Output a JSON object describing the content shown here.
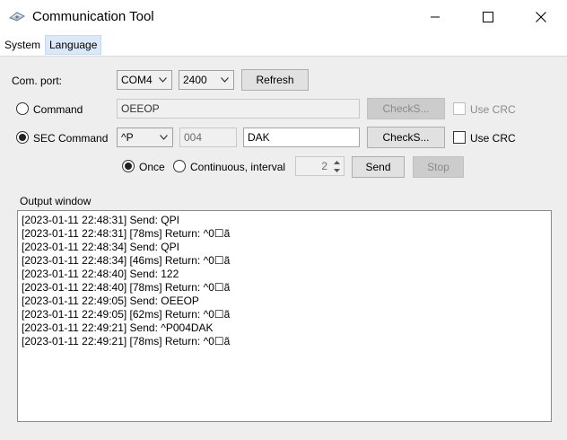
{
  "window": {
    "title": "Communication Tool",
    "icon": "app-gear-icon"
  },
  "menu": [
    "System",
    "Language"
  ],
  "comport": {
    "label": "Com. port:",
    "port": "COM4",
    "baud": "2400",
    "refresh_label": "Refresh"
  },
  "command": {
    "label": "Command",
    "value": "OEEOP",
    "checksum_label": "CheckS...",
    "use_crc_label": "Use CRC"
  },
  "sec_command": {
    "label": "SEC Command",
    "prefix": "^P",
    "number": "004",
    "value": "DAK",
    "checksum_label": "CheckS...",
    "use_crc_label": "Use CRC"
  },
  "send_mode": {
    "once_label": "Once",
    "continuous_label": "Continuous, interval",
    "interval": "2",
    "send_label": "Send",
    "stop_label": "Stop"
  },
  "output": {
    "label": "Output window",
    "lines": [
      "[2023-01-11 22:48:31] Send: QPI",
      "[2023-01-11 22:48:31] [78ms] Return: ^0☐ã",
      "[2023-01-11 22:48:34] Send: QPI",
      "[2023-01-11 22:48:34] [46ms] Return: ^0☐ã",
      "[2023-01-11 22:48:40] Send: 122",
      "[2023-01-11 22:48:40] [78ms] Return: ^0☐ã",
      "[2023-01-11 22:49:05] Send: OEEOP",
      "[2023-01-11 22:49:05] [62ms] Return: ^0☐ã",
      "[2023-01-11 22:49:21] Send: ^P004DAK",
      "[2023-01-11 22:49:21] [78ms] Return: ^0☐ã"
    ]
  }
}
